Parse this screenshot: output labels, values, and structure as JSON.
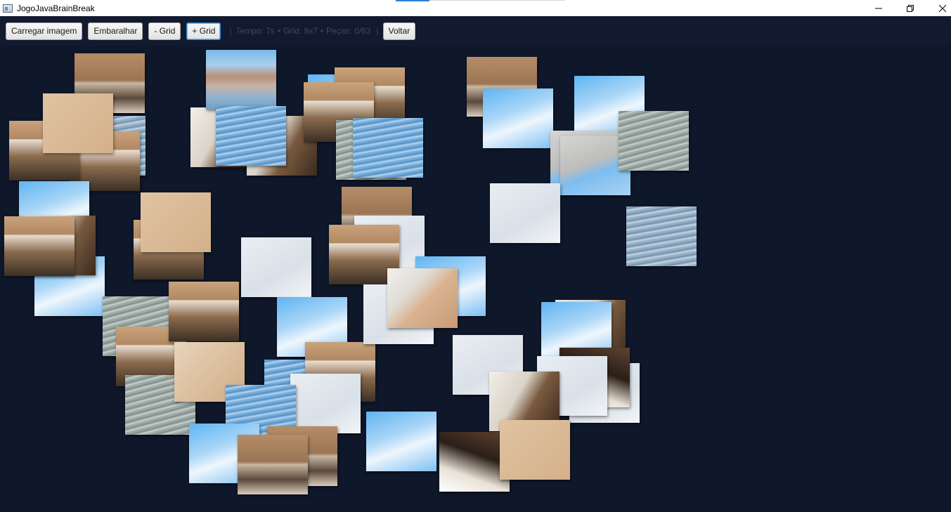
{
  "window": {
    "title": "JogoJavaBrainBreak",
    "minimize_icon": "minimize-icon",
    "maximize_icon": "restore-icon",
    "close_icon": "close-icon"
  },
  "toolbar": {
    "load_image_label": "Carregar imagem",
    "shuffle_label": "Embaralhar",
    "grid_minus_label": "- Grid",
    "grid_plus_label": "+ Grid",
    "separator": "|",
    "status_time": "Tempo: 7s",
    "status_dot": "•",
    "status_grid": "Grid: 9x7",
    "status_pieces": "Peças: 0/63",
    "back_label": "Voltar"
  },
  "colors": {
    "background": "#0f172a",
    "toolbar": "#111a2e",
    "focus_border": "#2f8fd8"
  },
  "puzzle": {
    "grid": "9x7",
    "total_pieces": 63,
    "placed_pieces": 0
  }
}
